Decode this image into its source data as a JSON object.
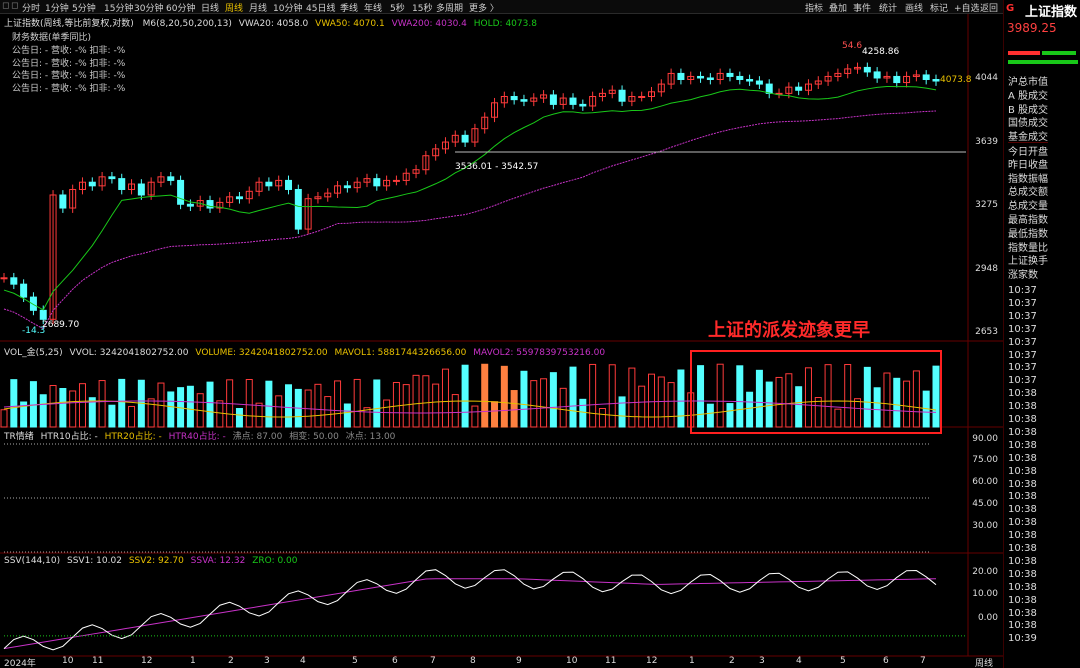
{
  "topbar": {
    "tabs": [
      "分时",
      "1分钟",
      "5分钟",
      "15分钟",
      "30分钟",
      "60分钟",
      "日线",
      "周线",
      "月线",
      "10分钟",
      "45日线",
      "季线",
      "年线",
      "5秒",
      "15秒",
      "多周期",
      "更多 〉"
    ],
    "active_tab": "周线",
    "right_buttons": [
      "指标",
      "叠加",
      "事件",
      "统计",
      "画线",
      "标记",
      "+自选",
      "返回"
    ]
  },
  "main_legend": {
    "title": "上证指数(周线,等比前复权,对数)",
    "indicator": "M6(8,20,50,200,13)",
    "vwa20": "VWA20: 4058.0",
    "vwa50": "VWA50: 4070.1",
    "vwa200": "VWA200: 4030.4",
    "hold": "HOLD: 4073.8"
  },
  "finance": {
    "header": "财务数据(单季同比)",
    "rows": [
      "公告日: -    营收: -%    扣非: -%",
      "公告日: -    营收: -%    扣非: -%",
      "公告日: -    营收: -%    扣非: -%",
      "公告日: -    营收: -%    扣非: -%"
    ]
  },
  "main_axis": [
    "4044",
    "3639",
    "3275",
    "2948",
    "2653"
  ],
  "annotations": {
    "high_top": "54.6",
    "high": "4258.86",
    "hold_val": "4073.8",
    "mid": "3536.01 - 3542.57",
    "low": "2689.70",
    "low_pct": "-14.3",
    "overlay_text": "上证的派发迹象更早"
  },
  "vol_legend": {
    "name": "VOL_金(5,25)",
    "vvol": "VVOL: 3242041802752.00",
    "volume": "VOLUME: 3242041802752.00",
    "mavol1": "MAVOL1: 5881744326656.00",
    "mavol2": "MAVOL2: 5597839753216.00"
  },
  "tr_legend": {
    "name": "TR情绪",
    "htr10": "HTR10占比: -",
    "htr20": "HTR20占比: -",
    "htr40": "HTR40占比: -",
    "boil": "沸点: 87.00",
    "phase": "相变: 50.00",
    "ice": "冰点: 13.00"
  },
  "tr_axis": [
    "90.00",
    "75.00",
    "60.00",
    "45.00",
    "30.00"
  ],
  "ssv_legend": {
    "name": "SSV(144,10)",
    "ssv1": "SSV1: 10.02",
    "ssv2": "SSV2: 92.70",
    "ssva": "SSVA: 12.32",
    "zro": "ZRO: 0.00"
  },
  "ssv_axis": [
    "20.00",
    "10.00",
    "0.00"
  ],
  "date_axis": [
    "2024年",
    "10",
    "11",
    "12",
    "1",
    "2",
    "3",
    "4",
    "5",
    "6",
    "7",
    "8",
    "9",
    "10",
    "11",
    "12",
    "1",
    "2",
    "3",
    "4",
    "5",
    "6",
    "7"
  ],
  "date_axis_unit": "周线",
  "right_panel": {
    "name_prefix": "G",
    "name": "上证指数",
    "price": "3989.25",
    "items": [
      "沪总市值",
      "A 股成交",
      "B 股成交",
      "国债成交",
      "基金成交",
      "今日开盘",
      "昨日收盘",
      "指数振幅",
      "总成交额",
      "总成交量",
      "最高指数",
      "最低指数",
      "指数量比",
      "上证换手",
      "涨家数"
    ],
    "times": [
      "10:37",
      "10:37",
      "10:37",
      "10:37",
      "10:37",
      "10:37",
      "10:37",
      "10:37",
      "10:38",
      "10:38",
      "10:38",
      "10:38",
      "10:38",
      "10:38",
      "10:38",
      "10:38",
      "10:38",
      "10:38",
      "10:38",
      "10:38",
      "10:38",
      "10:38",
      "10:38",
      "10:38",
      "10:38",
      "10:38",
      "10:38",
      "10:39"
    ]
  },
  "colors": {
    "up": "#ff3b3b",
    "down": "#54ffff",
    "ma1": "#19c819",
    "ma2": "#c832c8",
    "vol_ma1": "#e8c000",
    "highlight_box": "#ff2020",
    "accent": "#e8c000"
  }
}
